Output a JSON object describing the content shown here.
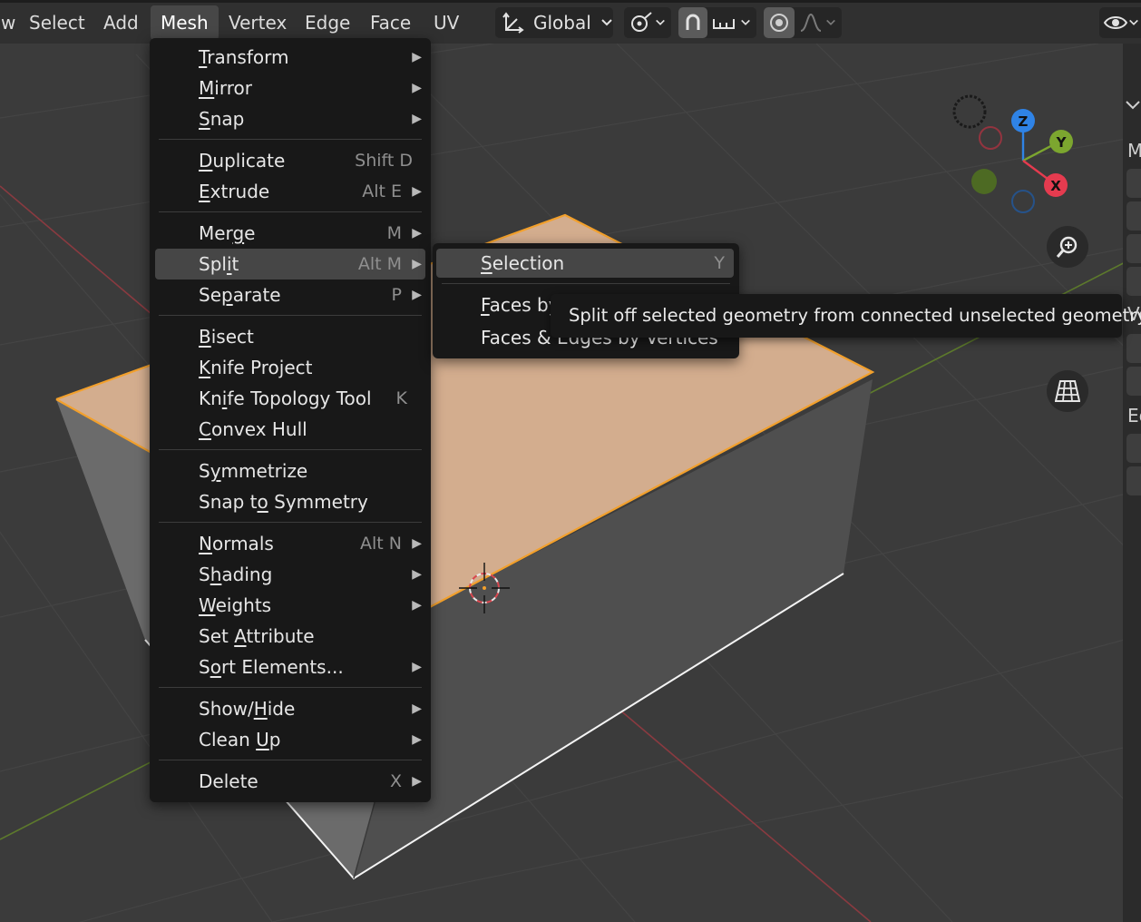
{
  "header": {
    "menus": [
      {
        "label": "Select"
      },
      {
        "label": "Add"
      },
      {
        "label": "Mesh"
      },
      {
        "label": "Vertex"
      },
      {
        "label": "Edge"
      },
      {
        "label": "Face"
      },
      {
        "label": "UV"
      }
    ],
    "left_cut": "w",
    "transform_orientation": "Global"
  },
  "mesh_menu": {
    "items": [
      {
        "label": "Transform",
        "mn": "T",
        "rest": "ransform",
        "shortcut": "",
        "submenu": true
      },
      {
        "label": "Mirror",
        "mn": "M",
        "rest": "irror",
        "shortcut": "",
        "submenu": true
      },
      {
        "label": "Snap",
        "mn": "S",
        "rest": "nap",
        "shortcut": "",
        "submenu": true
      },
      {
        "label": "Duplicate",
        "mn": "D",
        "rest": "uplicate",
        "shortcut": "Shift D",
        "submenu": false
      },
      {
        "label": "Extrude",
        "mn": "E",
        "rest": "xtrude",
        "shortcut": "Alt E",
        "submenu": true
      },
      {
        "label": "Merge",
        "pre": "Mer",
        "mn": "g",
        "rest": "e",
        "shortcut": "M",
        "submenu": true
      },
      {
        "label": "Split",
        "pre": "Spl",
        "mn": "i",
        "rest": "t",
        "shortcut": "Alt M",
        "submenu": true
      },
      {
        "label": "Separate",
        "pre": "Se",
        "mn": "p",
        "rest": "arate",
        "shortcut": "P",
        "submenu": true
      },
      {
        "label": "Bisect",
        "mn": "B",
        "rest": "isect",
        "shortcut": "",
        "submenu": false
      },
      {
        "label": "Knife Project",
        "mn": "K",
        "rest": "nife Project",
        "shortcut": "",
        "submenu": false
      },
      {
        "label": "Knife Topology Tool",
        "pre": "Kn",
        "mn": "i",
        "rest": "fe Topology Tool",
        "shortcut": "K",
        "submenu": false
      },
      {
        "label": "Convex Hull",
        "mn": "C",
        "rest": "onvex Hull",
        "shortcut": "",
        "submenu": false
      },
      {
        "label": "Symmetrize",
        "pre": "S",
        "mn": "y",
        "rest": "mmetrize",
        "shortcut": "",
        "submenu": false
      },
      {
        "label": "Snap to Symmetry",
        "pre": "Snap t",
        "mn": "o",
        "rest": " Symmetry",
        "shortcut": "",
        "submenu": false
      },
      {
        "label": "Normals",
        "mn": "N",
        "rest": "ormals",
        "shortcut": "Alt N",
        "submenu": true
      },
      {
        "label": "Shading",
        "pre": "S",
        "mn": "h",
        "rest": "ading",
        "shortcut": "",
        "submenu": true
      },
      {
        "label": "Weights",
        "mn": "W",
        "rest": "eights",
        "shortcut": "",
        "submenu": true
      },
      {
        "label": "Set Attribute",
        "pre": "Set ",
        "mn": "A",
        "rest": "ttribute",
        "shortcut": "",
        "submenu": false
      },
      {
        "label": "Sort Elements...",
        "pre": "S",
        "mn": "o",
        "rest": "rt Elements...",
        "shortcut": "",
        "submenu": true
      },
      {
        "label": "Show/Hide",
        "pre": "Show/",
        "mn": "H",
        "rest": "ide",
        "shortcut": "",
        "submenu": true
      },
      {
        "label": "Clean Up",
        "pre": "Clean ",
        "mn": "U",
        "rest": "p",
        "shortcut": "",
        "submenu": true
      },
      {
        "label": "Delete",
        "mn": "",
        "rest": "Delete",
        "shortcut": "X",
        "submenu": true
      }
    ]
  },
  "split_submenu": {
    "items": [
      {
        "label": "Selection",
        "mn": "S",
        "rest": "election",
        "shortcut": "Y"
      },
      {
        "label": "Faces by",
        "mn": "F",
        "rest": "aces by",
        "shortcut": ""
      },
      {
        "label": "Faces & Edges by Vertices",
        "mn": "",
        "rest": "Faces & Edges by Vertices",
        "shortcut": ""
      }
    ]
  },
  "tooltip": {
    "text": "Split off selected geometry from connected unselected geometry."
  },
  "gizmo": {
    "z_label": "Z",
    "y_label": "Y",
    "x_label": "X",
    "z_color": "#2f83e6",
    "y_color": "#7ca62f",
    "x_color": "#e53b4f",
    "negative_x_color": "#93343f",
    "negative_y_color": "#4d6a23",
    "negative_z_color": "#265289"
  },
  "n_panel": {
    "labels": [
      "M",
      "Ve",
      "Ed"
    ]
  },
  "colors": {
    "selected_face": "#d3ad8e",
    "selected_edge": "#f2a02c",
    "mesh_side": "#4f4f4f",
    "menu_bg": "#181818",
    "menu_highlight": "#464646"
  }
}
